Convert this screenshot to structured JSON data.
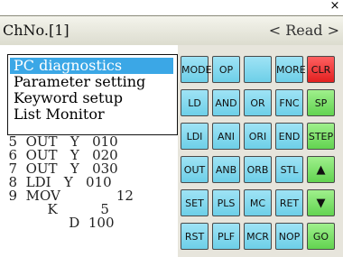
{
  "window": {
    "close_label": "×"
  },
  "title_bar": {
    "channel": "ChNo.[1]",
    "mode": "< Read >"
  },
  "menu": {
    "items": [
      {
        "label": "PC diagnostics",
        "selected": true
      },
      {
        "label": "Parameter setting",
        "selected": false
      },
      {
        "label": "Keyword setup",
        "selected": false
      },
      {
        "label": "List Monitor",
        "selected": false
      }
    ]
  },
  "program": {
    "lines": [
      "  5  OUT   Y   010",
      "  6  OUT   Y   020",
      "  7  OUT   Y   030",
      "  8  LDI   Y   010",
      "  9  MOV             12",
      "           K          5",
      "                D  100"
    ]
  },
  "keypad": {
    "rows": [
      [
        "MODE",
        "OP",
        "",
        "MORE",
        "CLR"
      ],
      [
        "LD",
        "AND",
        "OR",
        "FNC",
        "SP"
      ],
      [
        "LDI",
        "ANI",
        "ORI",
        "END",
        "STEP"
      ],
      [
        "OUT",
        "ANB",
        "ORB",
        "STL",
        "▲"
      ],
      [
        "SET",
        "PLS",
        "MC",
        "RET",
        "▼"
      ],
      [
        "RST",
        "PLF",
        "MCR",
        "NOP",
        "GO"
      ]
    ],
    "colors": {
      "blue": "#7fd7ee",
      "green": "#76e060",
      "red": "#ee3030"
    }
  }
}
